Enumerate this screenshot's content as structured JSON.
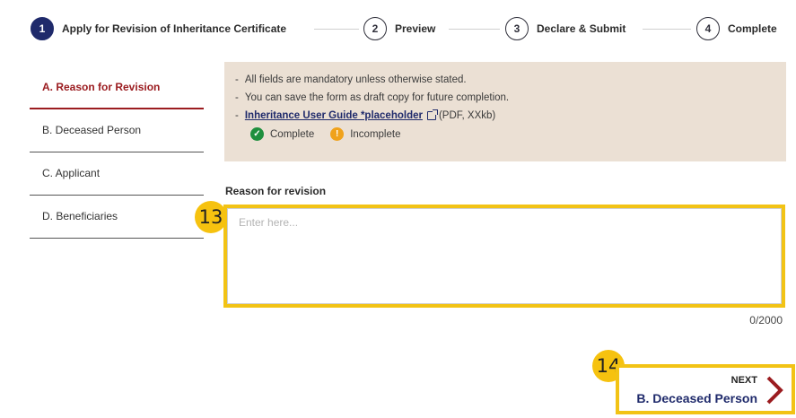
{
  "stepper": {
    "steps": [
      {
        "number": "1",
        "label": "Apply for Revision of Inheritance Certificate"
      },
      {
        "number": "2",
        "label": "Preview"
      },
      {
        "number": "3",
        "label": "Declare & Submit"
      },
      {
        "number": "4",
        "label": "Complete"
      }
    ]
  },
  "sidebar": {
    "items": [
      {
        "label": "A. Reason for Revision"
      },
      {
        "label": "B. Deceased Person"
      },
      {
        "label": "C. Applicant"
      },
      {
        "label": "D. Beneficiaries"
      }
    ]
  },
  "info": {
    "line1": "All fields are mandatory unless otherwise stated.",
    "line2": "You can save the form as draft copy for future completion.",
    "guide_link": "Inheritance User Guide *placeholder",
    "guide_meta": "(PDF, XXkb)",
    "dash": "-",
    "legend_complete": "Complete",
    "legend_incomplete": "Incomplete",
    "check_glyph": "✓",
    "warn_glyph": "!"
  },
  "form": {
    "label": "Reason for revision",
    "placeholder": "Enter here...",
    "counter": "0/2000"
  },
  "annotations": {
    "marker13": "13",
    "marker14": "14"
  },
  "next_button": {
    "small": "NEXT",
    "big": "B. Deceased Person"
  },
  "colors": {
    "primary": "#1f2a6b",
    "active_section": "#9b1c20",
    "highlight": "#f2c315",
    "info_bg": "#ebe0d4"
  }
}
